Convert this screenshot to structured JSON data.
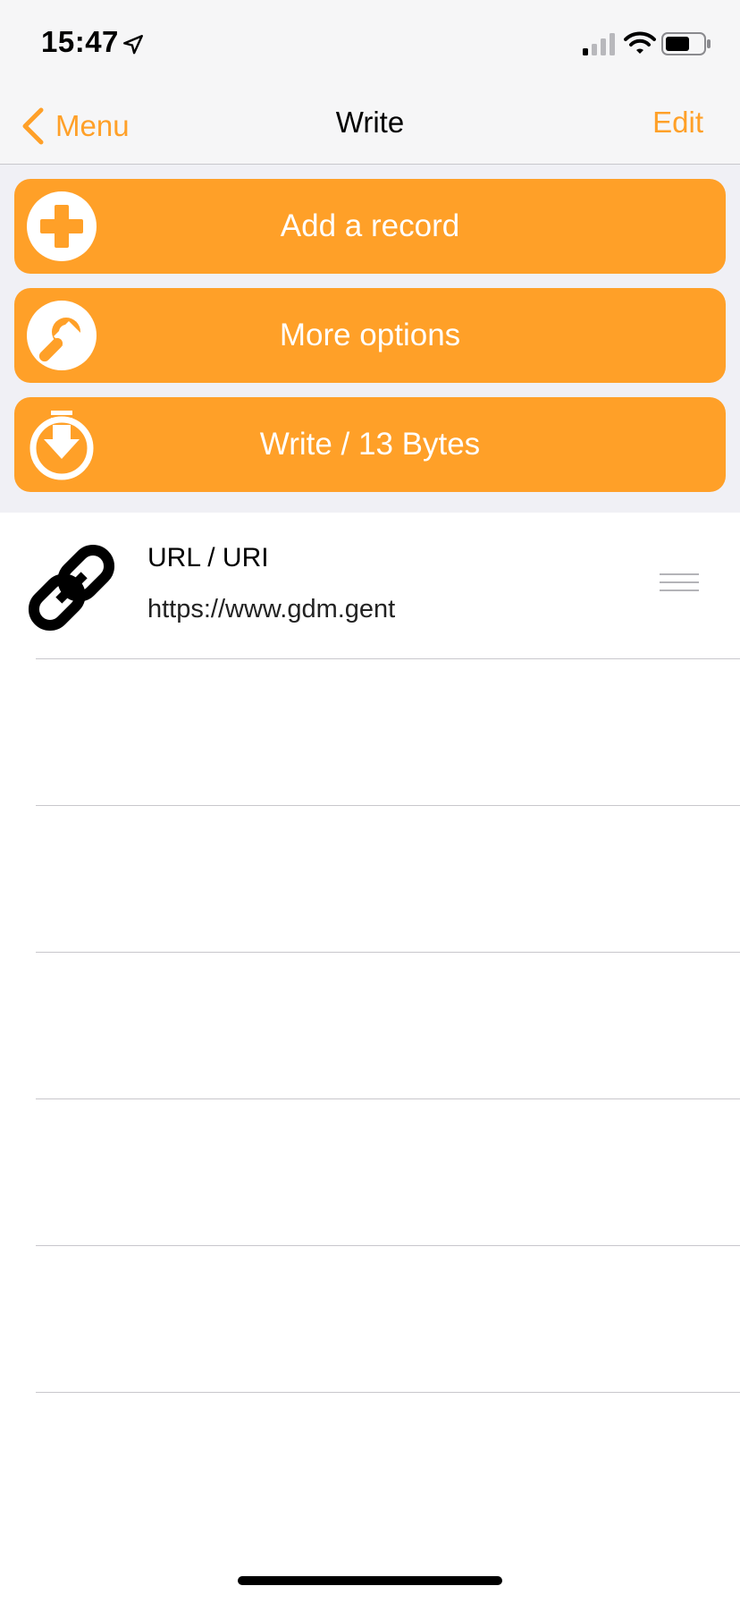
{
  "status_bar": {
    "time": "15:47"
  },
  "nav": {
    "back_label": "Menu",
    "title": "Write",
    "edit_label": "Edit"
  },
  "actions": [
    {
      "label": "Add a record",
      "icon": "plus-circle-icon"
    },
    {
      "label": "More options",
      "icon": "wrench-icon"
    },
    {
      "label": "Write / 13 Bytes",
      "icon": "download-circle-icon"
    }
  ],
  "records": [
    {
      "type": "URL / URI",
      "value": "https://www.gdm.gent",
      "icon": "link-icon"
    }
  ],
  "colors": {
    "accent": "#ffa028",
    "nav_background": "#f6f6f7",
    "section_background": "#f0f0f5",
    "separator": "#c8c7cc"
  }
}
